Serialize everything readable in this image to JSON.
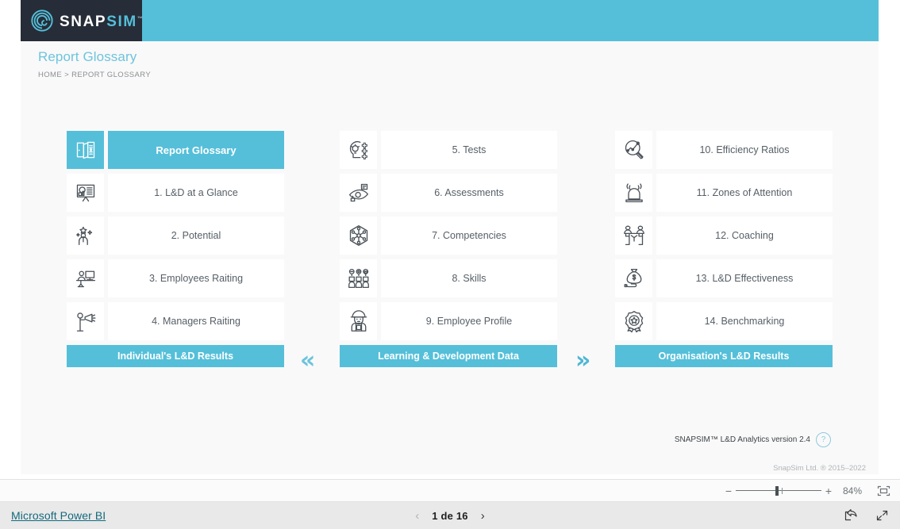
{
  "brand": {
    "logo_snap": "SNAP",
    "logo_sim": "SIM",
    "logo_tm": "™",
    "logo_icon": "spiral-target-icon",
    "header_color": "#55bfd9",
    "logo_block_color": "#262d38"
  },
  "header": {
    "title": "Report Glossary",
    "breadcrumb": "HOME > REPORT GLOSSARY"
  },
  "columns": [
    {
      "id": "individual",
      "footer_label": "Individual's L&D Results",
      "items": [
        {
          "label": "Report Glossary",
          "icon": "open-book-icon",
          "selected": true
        },
        {
          "label": "1. L&D at a Glance",
          "icon": "presentation-board-icon",
          "selected": false
        },
        {
          "label": "2. Potential",
          "icon": "employee-star-icon",
          "selected": false
        },
        {
          "label": "3. Employees Raiting",
          "icon": "desk-worker-icon",
          "selected": false
        },
        {
          "label": "4. Managers Raiting",
          "icon": "megaphone-person-icon",
          "selected": false
        }
      ]
    },
    {
      "id": "learning-data",
      "footer_label": "Learning & Development Data",
      "items": [
        {
          "label": "5. Tests",
          "icon": "head-lightbulb-icon",
          "selected": false
        },
        {
          "label": "6. Assessments",
          "icon": "eye-review-icon",
          "selected": false
        },
        {
          "label": "7. Competencies",
          "icon": "hex-network-icon",
          "selected": false
        },
        {
          "label": "8. Skills",
          "icon": "three-people-icon",
          "selected": false
        },
        {
          "label": "9. Employee Profile",
          "icon": "worker-profile-icon",
          "selected": false
        }
      ]
    },
    {
      "id": "organisation",
      "footer_label": "Organisation's L&D Results",
      "items": [
        {
          "label": "10. Efficiency Ratios",
          "icon": "magnifier-chart-icon",
          "selected": false
        },
        {
          "label": "11. Zones of Attention",
          "icon": "alarm-light-icon",
          "selected": false
        },
        {
          "label": "12. Coaching",
          "icon": "handshake-people-icon",
          "selected": false
        },
        {
          "label": "13. L&D Effectiveness",
          "icon": "money-bag-hand-icon",
          "selected": false
        },
        {
          "label": "14. Benchmarking",
          "icon": "award-star-icon",
          "selected": false
        }
      ]
    }
  ],
  "nav": {
    "prev_glyph": "«",
    "next_glyph": "»"
  },
  "footer": {
    "version_text": "SNAPSIM™ L&D Analytics version 2.4",
    "help_glyph": "?",
    "copyright": "SnapSim Ltd. ® 2015–2022"
  },
  "zoombar": {
    "minus": "−",
    "plus": "+",
    "value": "84%",
    "fit_icon": "fit-to-page-icon"
  },
  "statusbar": {
    "powerbi_link": "Microsoft Power BI",
    "prev_glyph": "‹",
    "page_label": "1 de 16",
    "next_glyph": "›",
    "share_icon": "share-icon",
    "fullscreen_icon": "fullscreen-icon"
  }
}
